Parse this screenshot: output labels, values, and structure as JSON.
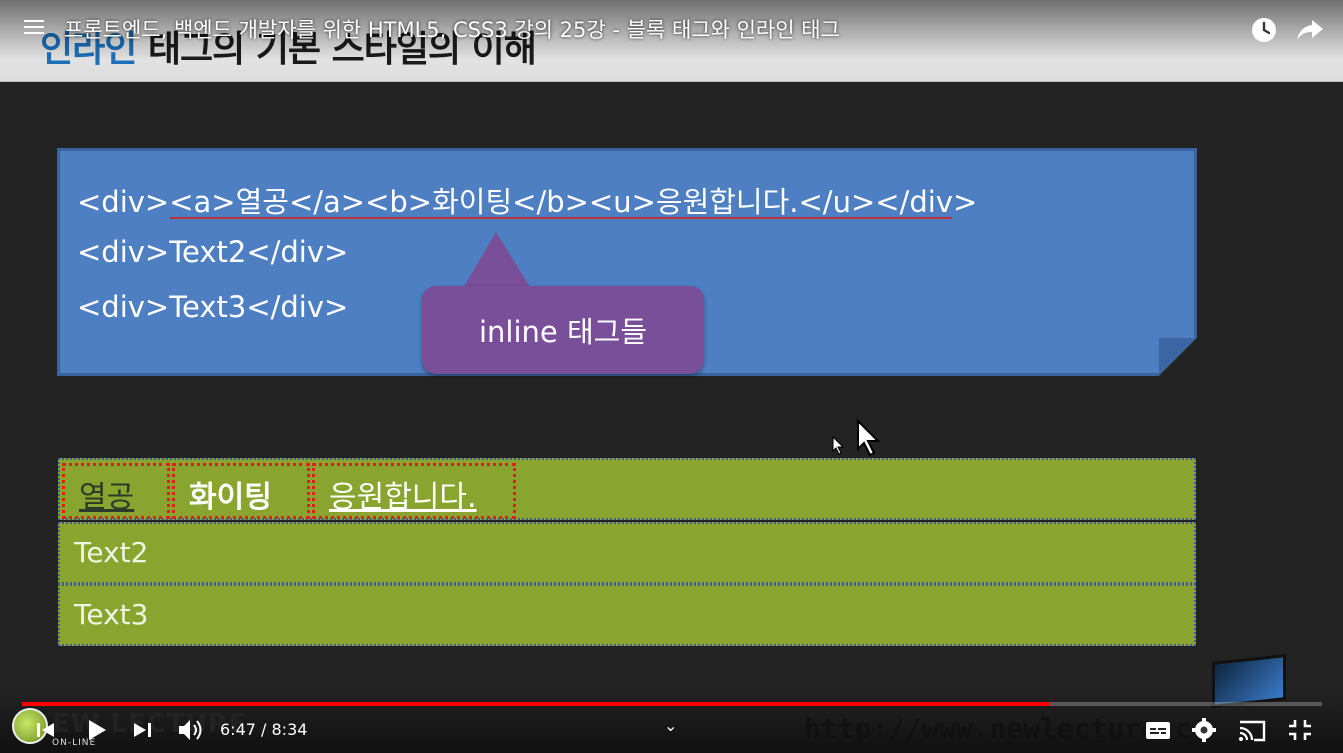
{
  "slide": {
    "title_accent": "인라인",
    "title_rest": "태그의 기본 스타일의 이해",
    "code": {
      "line1": "<div><a>열공</a><b>화이팅</b><u>응원합니다.</u></div>",
      "line2": "<div>Text2</div>",
      "line3": "<div>Text3</div>"
    },
    "callout": "inline 태그들",
    "demo": {
      "inline_a": "열공",
      "inline_b": "화이팅",
      "inline_u": "응원합니다.",
      "row2": "Text2",
      "row3": "Text3"
    },
    "watermark_url": "http://www.newlecture.com",
    "logo": {
      "main": "EW LECTURE",
      "sub": "ON-LINE"
    }
  },
  "player": {
    "video_title": "프론트엔드, 백엔드 개발자를 위한 HTML5, CSS3 강의 25강 - 블록 태그와 인라인 태그",
    "time_current": "6:47",
    "time_total": "8:34",
    "time_display": "6:47 / 8:34",
    "progress_fraction": 0.791,
    "chevron": "⌄",
    "accent_color": "#ff0000"
  },
  "icons": [
    "menu-icon",
    "watch-later-icon",
    "share-icon",
    "previous-icon",
    "play-icon",
    "next-icon",
    "volume-icon",
    "captions-icon",
    "settings-icon",
    "cast-icon",
    "exit-fullscreen-icon",
    "mouse-cursor-icon"
  ]
}
